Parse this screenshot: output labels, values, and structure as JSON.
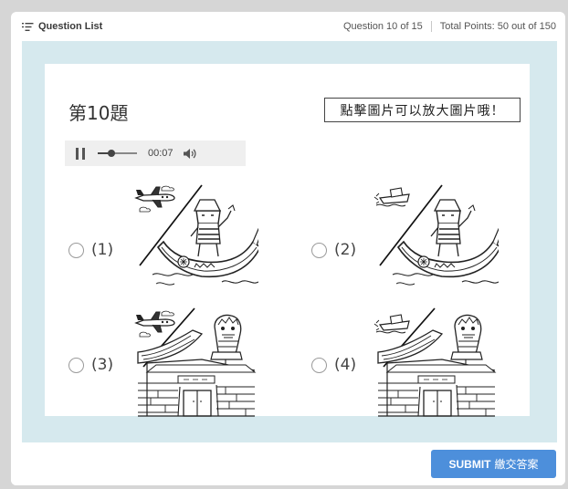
{
  "topbar": {
    "question_list_label": "Question List",
    "question_progress": "Question 10 of 15",
    "total_points": "Total Points: 50 out of 150"
  },
  "question": {
    "title": "第10題",
    "zoom_hint": "點擊圖片可以放大圖片哦！"
  },
  "audio": {
    "time": "00:07",
    "progress": 0.35,
    "state": "playing"
  },
  "options": [
    {
      "label": "(1)",
      "picture": "airplane-and-person-in-boat"
    },
    {
      "label": "(2)",
      "picture": "boat-and-person-in-boat"
    },
    {
      "label": "(3)",
      "picture": "airplane-and-temple-lion"
    },
    {
      "label": "(4)",
      "picture": "boat-and-temple-lion"
    }
  ],
  "footer": {
    "submit_en": "SUBMIT",
    "submit_zh": "繳交答案"
  },
  "colors": {
    "stage_bg": "#d6e9ee",
    "submit_bg": "#4d8fdb",
    "page_bg": "#d6d6d6"
  }
}
